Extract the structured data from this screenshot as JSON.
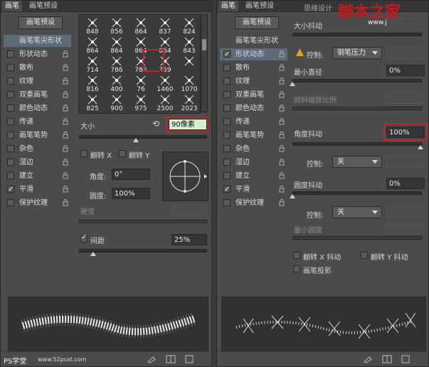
{
  "left_panel": {
    "tabs": [
      "画笔",
      "画笔预设"
    ],
    "preset_button": "画笔预设",
    "options": [
      {
        "label": "画笔笔尖形状",
        "checked": false,
        "selected": true,
        "lock": false
      },
      {
        "label": "形状动态",
        "checked": false,
        "lock": true
      },
      {
        "label": "散布",
        "checked": false,
        "lock": true
      },
      {
        "label": "纹理",
        "checked": false,
        "lock": true
      },
      {
        "label": "双重画笔",
        "checked": false,
        "lock": true
      },
      {
        "label": "颜色动态",
        "checked": false,
        "lock": true
      },
      {
        "label": "传递",
        "checked": false,
        "lock": true
      },
      {
        "label": "画笔笔势",
        "checked": false,
        "lock": true
      },
      {
        "label": "杂色",
        "checked": false,
        "lock": true
      },
      {
        "label": "湿边",
        "checked": false,
        "lock": true
      },
      {
        "label": "建立",
        "checked": false,
        "lock": true
      },
      {
        "label": "平滑",
        "checked": true,
        "lock": true
      },
      {
        "label": "保护纹理",
        "checked": false,
        "lock": true
      }
    ],
    "brush_sizes": [
      [
        "848",
        "856",
        "864",
        "837",
        "824"
      ],
      [
        "864",
        "864",
        "864",
        "864",
        "843"
      ],
      [
        "714",
        "786",
        "786",
        "759",
        ""
      ],
      [
        "816",
        "400",
        "76",
        "1460",
        "1070"
      ],
      [
        "825",
        "900",
        "975",
        "2500",
        "2023"
      ]
    ],
    "size_label": "大小",
    "size_value": "90像素",
    "flip_x": "翻转 X",
    "flip_y": "翻转 Y",
    "angle_label": "角度:",
    "angle_value": "0°",
    "roundness_label": "圆度:",
    "roundness_value": "100%",
    "hardness_label": "硬度",
    "spacing_label": "间距",
    "spacing_value": "25%"
  },
  "right_panel": {
    "tabs": [
      "画笔",
      "画笔预设"
    ],
    "preset_button": "画笔预设",
    "watermark": "脚本之家",
    "watermark_url": "www.jb51.net",
    "watermark_side": "思缘设计",
    "options": [
      {
        "label": "画笔笔尖形状",
        "checked": false,
        "selected": false,
        "lock": false
      },
      {
        "label": "形状动态",
        "checked": true,
        "selected": true,
        "lock": true
      },
      {
        "label": "散布",
        "checked": false,
        "lock": true
      },
      {
        "label": "纹理",
        "checked": false,
        "lock": true
      },
      {
        "label": "双重画笔",
        "checked": false,
        "lock": true
      },
      {
        "label": "颜色动态",
        "checked": false,
        "lock": true
      },
      {
        "label": "传递",
        "checked": false,
        "lock": true
      },
      {
        "label": "画笔笔势",
        "checked": false,
        "lock": true
      },
      {
        "label": "杂色",
        "checked": false,
        "lock": true
      },
      {
        "label": "湿边",
        "checked": false,
        "lock": true
      },
      {
        "label": "建立",
        "checked": false,
        "lock": true
      },
      {
        "label": "平滑",
        "checked": true,
        "lock": true
      },
      {
        "label": "保护纹理",
        "checked": false,
        "lock": true
      }
    ],
    "size_jitter": "大小抖动",
    "control_label": "控制:",
    "control_value_pen": "钢笔压力",
    "min_diameter": "最小直径",
    "min_diameter_value": "0%",
    "tilt_scale": "倾斜缩放比例",
    "angle_jitter": "角度抖动",
    "angle_jitter_value": "100%",
    "control_value_off": "关",
    "roundness_jitter": "圆度抖动",
    "roundness_jitter_value": "0%",
    "min_roundness": "最小圆度",
    "flip_x_jitter": "翻转 X 抖动",
    "flip_y_jitter": "翻转 Y 抖动",
    "brush_projection": "画笔投影"
  },
  "footer": {
    "left_watermark": "PS学堂",
    "left_url": "www.52psxt.com"
  }
}
